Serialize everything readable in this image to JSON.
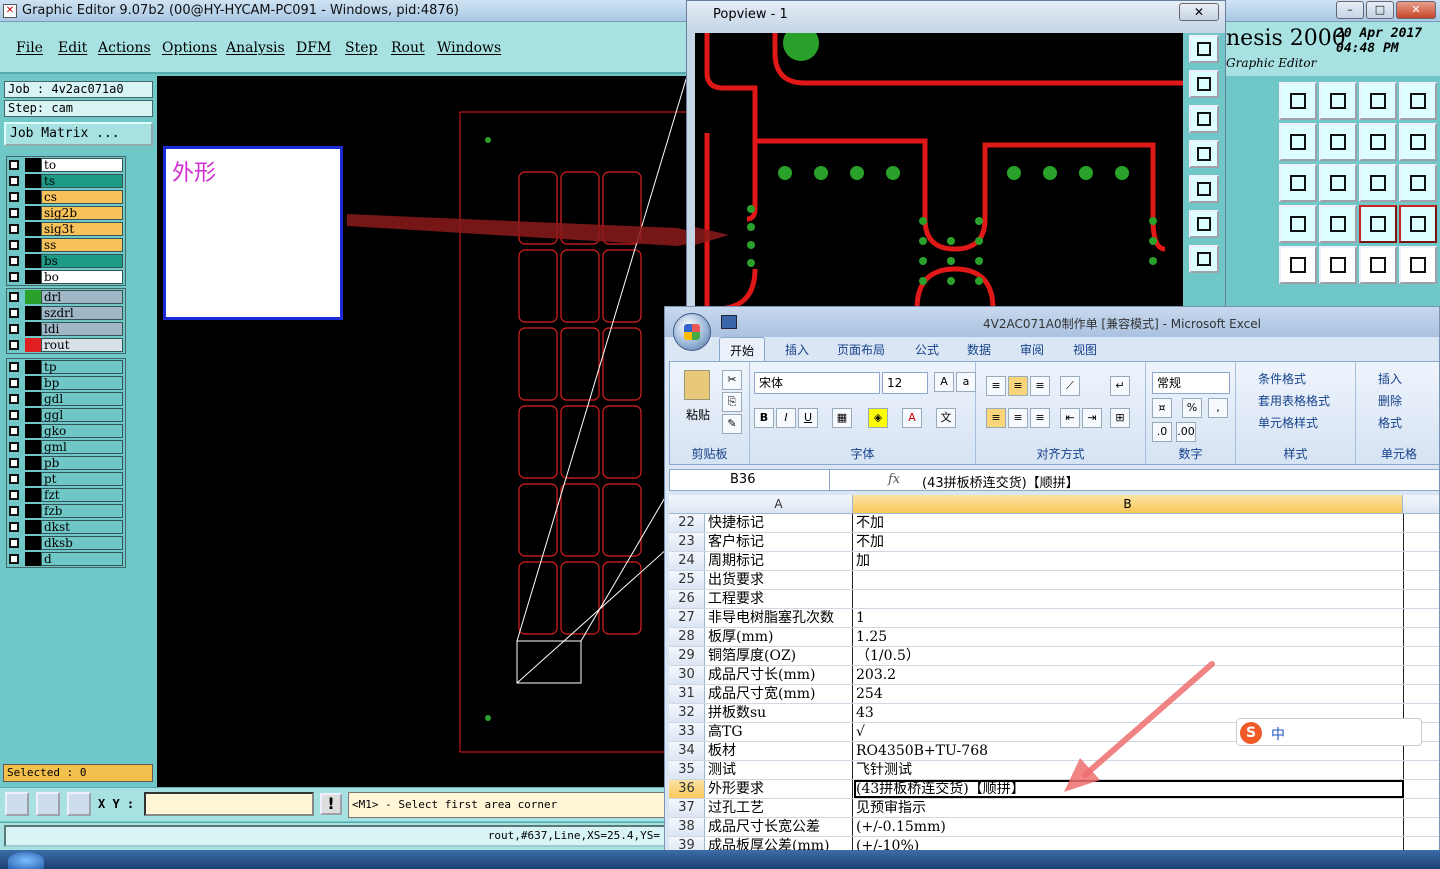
{
  "genesis": {
    "title": "Graphic Editor 9.07b2 (00@HY-HYCAM-PC091 - Windows, pid:4876)",
    "menu": [
      "File",
      "Edit",
      "Actions",
      "Options",
      "Analysis",
      "DFM",
      "Step",
      "Rout",
      "Windows"
    ],
    "logo": {
      "brand": "nesis 2000",
      "sub": "Graphic Editor",
      "date_line1": "20 Apr 2017",
      "date_line2": "04:48 PM"
    },
    "job": "Job : 4v2ac071a0",
    "step": "Step: cam",
    "job_matrix_label": "Job Matrix ...",
    "layers_board": [
      {
        "name": "to",
        "color": "#ffffff"
      },
      {
        "name": "ts",
        "color": "#1e9b86"
      },
      {
        "name": "cs",
        "color": "#f7c25a"
      },
      {
        "name": "sig2b",
        "color": "#f7c25a"
      },
      {
        "name": "sig3t",
        "color": "#f7c25a"
      },
      {
        "name": "ss",
        "color": "#f7c25a"
      },
      {
        "name": "bs",
        "color": "#1e9b86"
      },
      {
        "name": "bo",
        "color": "#ffffff"
      }
    ],
    "layers_drill": [
      {
        "name": "drl",
        "color": "#9fb7c6",
        "swatch": "#2aa12a"
      },
      {
        "name": "szdrl",
        "color": "#9fb7c6",
        "swatch": "#000000"
      },
      {
        "name": "ldi",
        "color": "#9fb7c6",
        "swatch": "#000000"
      },
      {
        "name": "rout",
        "color": "#d6e2e8",
        "swatch": "#e02020"
      }
    ],
    "layers_misc": [
      "tp",
      "bp",
      "gdl",
      "ggl",
      "gko",
      "gml",
      "pb",
      "pt",
      "fzt",
      "fzb",
      "dkst",
      "dksb",
      "d"
    ],
    "selected": "Selected : 0",
    "xy_label": "X Y :",
    "exclaim": "!",
    "prompt": "<M1> - Select first area corner",
    "status": "rout,#637,Line,XS=25.4,YS="
  },
  "annotation_label": "外形",
  "popview": {
    "title": "Popview - 1",
    "close": "✕"
  },
  "excel": {
    "title": "4V2AC071A0制作单  [兼容模式] - Microsoft Excel",
    "tabs": [
      "开始",
      "插入",
      "页面布局",
      "公式",
      "数据",
      "审阅",
      "视图"
    ],
    "groups": {
      "clipboard": "剪贴板",
      "paste": "粘贴",
      "font": "字体",
      "font_name": "宋体",
      "font_size": "12",
      "align": "对齐方式",
      "number": "数字",
      "number_format": "常规",
      "styles": "样式",
      "cond_fmt": "条件格式",
      "table_fmt": "套用表格格式",
      "cell_style": "单元格样式",
      "cells": "单元格",
      "insert": "插入",
      "delete": "删除",
      "format": "格式"
    },
    "name_box": "B36",
    "fx": "fx",
    "formula": "(43拼板桥连交货)【顺拼】",
    "col_a": "A",
    "col_b": "B",
    "rows": [
      {
        "n": "22",
        "a": "快捷标记",
        "b": "不加"
      },
      {
        "n": "23",
        "a": "客户标记",
        "b": "不加"
      },
      {
        "n": "24",
        "a": "周期标记",
        "b": "加"
      },
      {
        "n": "25",
        "a": "出货要求",
        "b": ""
      },
      {
        "n": "26",
        "a": "工程要求",
        "b": ""
      },
      {
        "n": "27",
        "a": "非导电树脂塞孔次数",
        "b": "1"
      },
      {
        "n": "28",
        "a": "板厚(mm)",
        "b": "1.25"
      },
      {
        "n": "29",
        "a": "铜箔厚度(OZ)",
        "b": "（1/0.5）"
      },
      {
        "n": "30",
        "a": "成品尺寸长(mm)",
        "b": "203.2"
      },
      {
        "n": "31",
        "a": "成品尺寸宽(mm)",
        "b": "254"
      },
      {
        "n": "32",
        "a": "拼板数su",
        "b": "43"
      },
      {
        "n": "33",
        "a": "高TG",
        "b": "√"
      },
      {
        "n": "34",
        "a": "板材",
        "b": "RO4350B+TU-768"
      },
      {
        "n": "35",
        "a": "测试",
        "b": "飞针测试"
      },
      {
        "n": "36",
        "a": "外形要求",
        "b": "(43拼板桥连交货)【顺拼】",
        "selected": true
      },
      {
        "n": "37",
        "a": "过孔工艺",
        "b": "见预审指示"
      },
      {
        "n": "38",
        "a": "成品尺寸长宽公差",
        "b": "(+/-0.15mm)"
      },
      {
        "n": "39",
        "a": "成品板厚公差(mm)",
        "b": "(+/-10%)"
      }
    ]
  },
  "ime": {
    "logo": "S",
    "mode": "中"
  }
}
